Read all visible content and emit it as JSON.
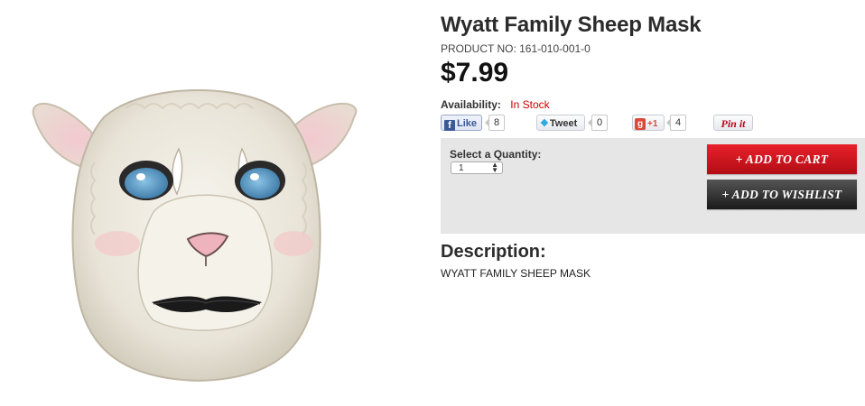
{
  "product": {
    "title": "Wyatt Family Sheep Mask",
    "product_no": "PRODUCT NO: 161-010-001-0",
    "price": "$7.99",
    "availability_label": "Availability:",
    "availability_value": "In Stock",
    "image_alt": "sheep-mask-image"
  },
  "social": {
    "facebook_label": "Like",
    "facebook_count": "8",
    "twitter_label": "Tweet",
    "twitter_count": "0",
    "googleplus_label": "+1",
    "googleplus_count": "4",
    "pinterest_label": "Pin it"
  },
  "purchase": {
    "quantity_label": "Select a Quantity:",
    "quantity_value": "1",
    "add_to_cart_label": "+ ADD TO CART",
    "add_to_wishlist_label": "+ ADD TO WISHLIST"
  },
  "description": {
    "heading": "Description:",
    "text": "WYATT FAMILY SHEEP MASK"
  },
  "colors": {
    "in_stock": "#cc0000",
    "cart_button": "#d0151f",
    "wishlist_button": "#2a2a2a",
    "panel_bg": "#e6e6e6"
  },
  "icons": [
    "facebook-icon",
    "twitter-icon",
    "googleplus-icon",
    "pinterest-icon",
    "select-arrows-icon"
  ]
}
